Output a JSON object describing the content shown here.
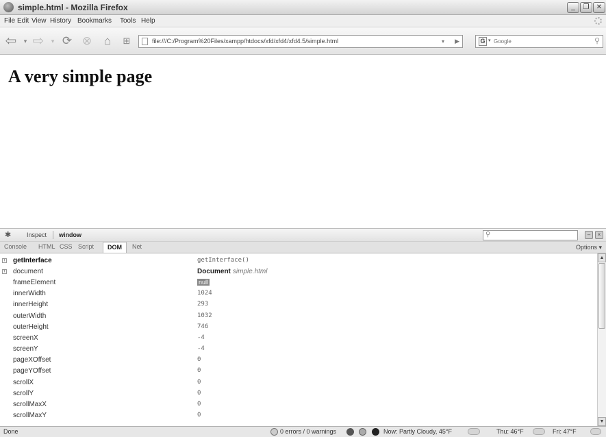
{
  "window": {
    "title": "simple.html - Mozilla Firefox"
  },
  "menu": [
    "File",
    "Edit",
    "View",
    "History",
    "Bookmarks",
    "Tools",
    "Help"
  ],
  "nav": {
    "url": "file:///C:/Program%20Files/xampp/htdocs/xfd/xfd4/xfd4.5/simple.html",
    "search_placeholder": "Google"
  },
  "page": {
    "heading": "A very simple page"
  },
  "firebug": {
    "inspect_label": "Inspect",
    "breadcrumb": "window",
    "tabs": [
      "Console",
      "HTML",
      "CSS",
      "Script",
      "DOM",
      "Net"
    ],
    "active_tab": "DOM",
    "options_label": "Options ▾"
  },
  "dom": {
    "rows": [
      {
        "name": "getInterface",
        "value": "getInterface()"
      },
      {
        "name": "document",
        "value_type": "Document",
        "value_link": "simple.html"
      },
      {
        "name": "frameElement",
        "value": "null"
      },
      {
        "name": "innerWidth",
        "value": "1024"
      },
      {
        "name": "innerHeight",
        "value": "293"
      },
      {
        "name": "outerWidth",
        "value": "1032"
      },
      {
        "name": "outerHeight",
        "value": "746"
      },
      {
        "name": "screenX",
        "value": "-4"
      },
      {
        "name": "screenY",
        "value": "-4"
      },
      {
        "name": "pageXOffset",
        "value": "0"
      },
      {
        "name": "pageYOffset",
        "value": "0"
      },
      {
        "name": "scrollX",
        "value": "0"
      },
      {
        "name": "scrollY",
        "value": "0"
      },
      {
        "name": "scrollMaxX",
        "value": "0"
      },
      {
        "name": "scrollMaxY",
        "value": "0"
      }
    ]
  },
  "status": {
    "left": "Done",
    "errors": "0 errors / 0 warnings",
    "weather_now": "Now: Partly Cloudy, 45°F",
    "forecast_thu": "Thu: 46°F",
    "forecast_fri": "Fri: 47°F"
  }
}
